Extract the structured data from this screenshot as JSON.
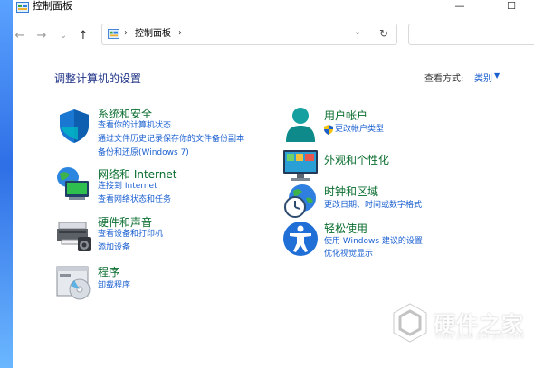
{
  "window": {
    "title": "控制面板",
    "minimize_glyph": "—",
    "maximize_glyph": "☐"
  },
  "nav": {
    "back_glyph": "←",
    "forward_glyph": "→",
    "recent_glyph": "⌄",
    "up_glyph": "↑",
    "address_sep": "›",
    "address_path": "控制面板",
    "address_trailing_sep": "›",
    "dropdown_glyph": "⌄",
    "refresh_glyph": "↻",
    "search_placeholder": ""
  },
  "main": {
    "title": "调整计算机的设置",
    "view_by_label": "查看方式:",
    "view_by_value": "类别",
    "view_by_caret": "▼"
  },
  "categories": [
    {
      "title": "系统和安全",
      "icon": "shield-icon",
      "links": [
        "查看你的计算机状态",
        "通过文件历史记录保存你的文件备份副本",
        "备份和还原(Windows 7)"
      ]
    },
    {
      "title": "网络和 Internet",
      "icon": "network-icon",
      "links": [
        "连接到 Internet",
        "查看网络状态和任务"
      ]
    },
    {
      "title": "硬件和声音",
      "icon": "printer-icon",
      "links": [
        "查看设备和打印机",
        "添加设备"
      ]
    },
    {
      "title": "程序",
      "icon": "programs-icon",
      "links": [
        "卸载程序"
      ]
    },
    {
      "title": "用户帐户",
      "icon": "user-icon",
      "links": [
        "更改帐户类型"
      ]
    },
    {
      "title": "外观和个性化",
      "icon": "monitor-icon",
      "links": []
    },
    {
      "title": "时钟和区域",
      "icon": "clock-globe-icon",
      "links": [
        "更改日期、时间或数字格式"
      ]
    },
    {
      "title": "轻松使用",
      "icon": "accessibility-icon",
      "links": [
        "使用 Windows 建议的设置",
        "优化视觉显示"
      ]
    }
  ],
  "watermark": {
    "title": "硬件之家",
    "subtitle": "YING JIAN ZHI JIA.COM"
  },
  "colors": {
    "category_title": "#0a6e2f",
    "link": "#1a5fd0",
    "page_title": "#1e3287"
  }
}
